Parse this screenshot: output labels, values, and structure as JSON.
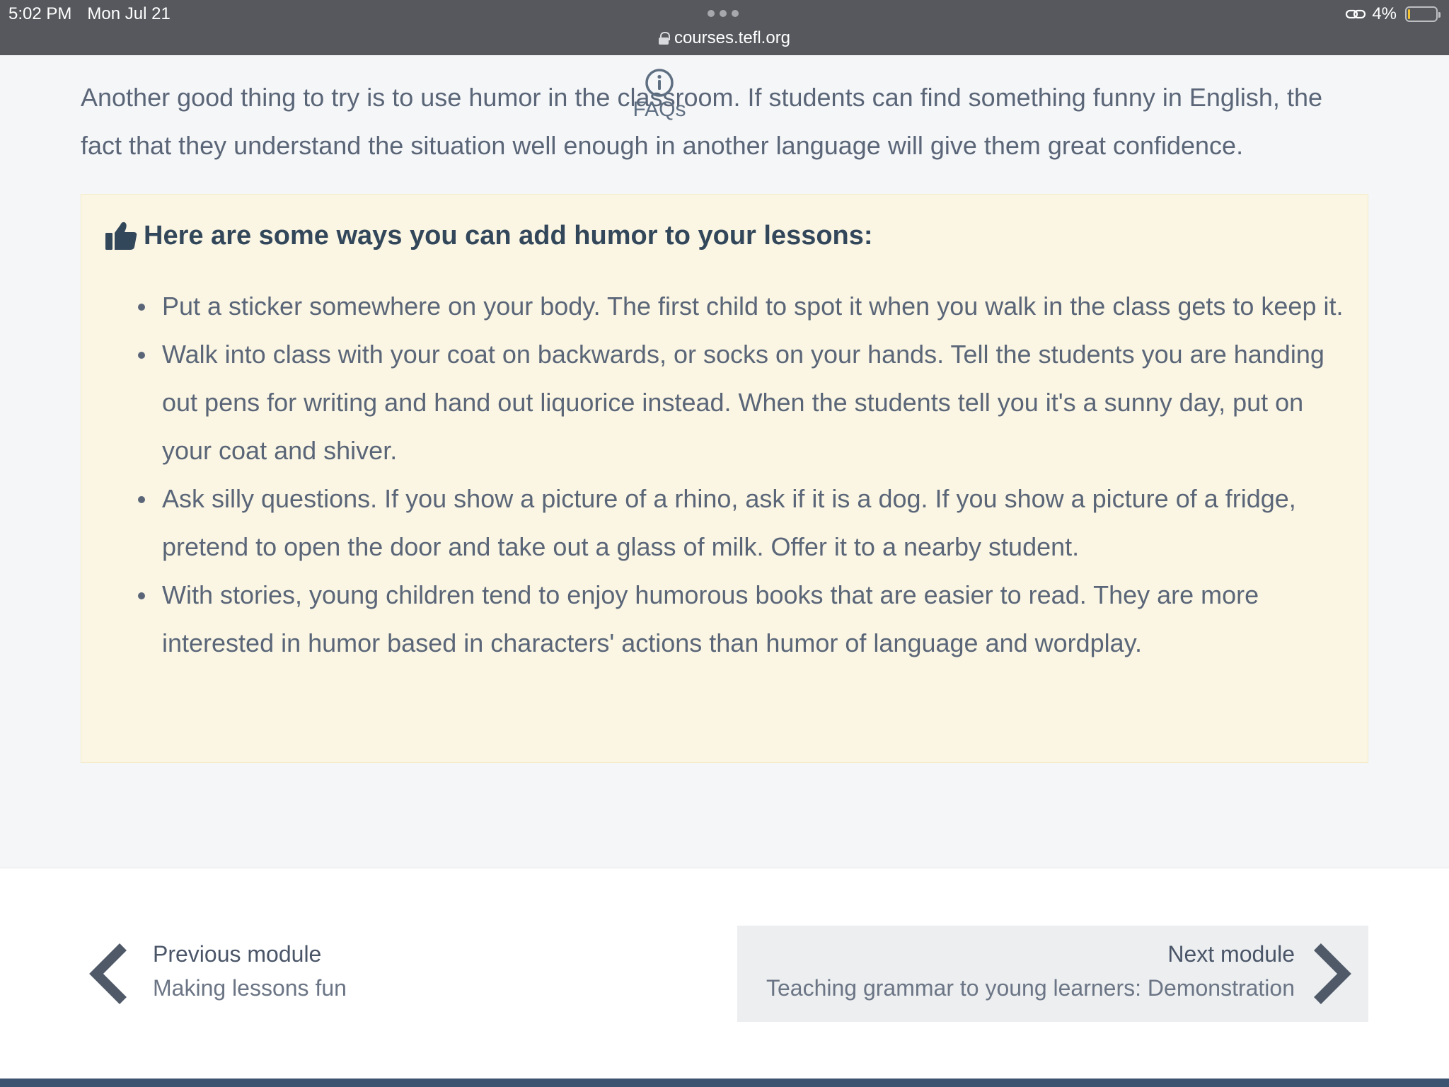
{
  "status_bar": {
    "time": "5:02 PM",
    "date": "Mon Jul 21",
    "battery": "4%",
    "battery_level": 0.04,
    "url": "courses.tefl.org"
  },
  "faqs": {
    "label": "FAQs",
    "icon": "info-circle-icon"
  },
  "intro_text": "Another good thing to try is to use humor in the classroom. If students can find something funny in English, the fact that they understand the situation well enough in another language will give them great confidence.",
  "tip_box": {
    "icon": "thumbs-up-icon",
    "title": "Here are some ways you can add humor to your lessons:",
    "items": [
      "Put a sticker somewhere on your body. The first child to spot it when you walk in the class gets to keep it.",
      "Walk into class with your coat on backwards, or socks on your hands. Tell the students you are handing out pens for writing and hand out liquorice instead. When the students tell you it's a sunny day, put on your coat and shiver.",
      "Ask silly questions. If you show a picture of a rhino, ask if it is a dog. If you show a picture of a fridge, pretend to open the door and take out a glass of milk. Offer it to a nearby student.",
      "With stories, young children tend to enjoy humorous books that are easier to read. They are more interested in humor based in characters' actions than humor of language and wordplay."
    ]
  },
  "navigation": {
    "previous": {
      "label": "Previous module",
      "title": "Making lessons fun"
    },
    "next": {
      "label": "Next module",
      "title": "Teaching grammar to young learners: Demonstration"
    }
  },
  "colors": {
    "status_bar": "#56585d",
    "page_bg": "#f5f6f8",
    "tip_box_bg": "#fbf6e4",
    "heading": "#33475b",
    "body_text": "#5a6678",
    "next_button_bg": "#eceef0",
    "footer_band": "#3d5470"
  }
}
